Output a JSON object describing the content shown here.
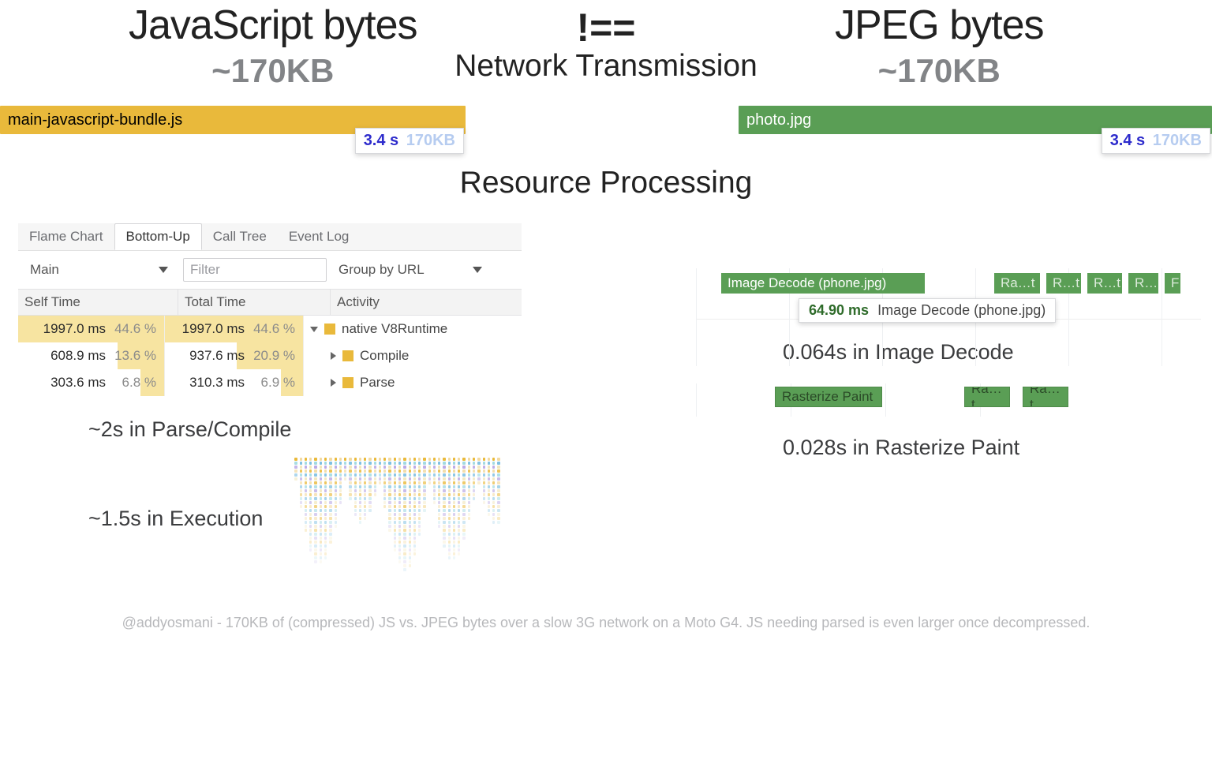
{
  "title_left": "JavaScript bytes",
  "title_neq": "!==",
  "title_right": "JPEG bytes",
  "size_left": "~170KB",
  "size_right": "~170KB",
  "heading_network": "Network Transmission",
  "heading_resource": "Resource Processing",
  "bars": {
    "js": {
      "label": "main-javascript-bundle.js",
      "time": "3.4 s",
      "size": "170KB"
    },
    "jpeg": {
      "label": "photo.jpg",
      "time": "3.4 s",
      "size": "170KB"
    }
  },
  "devtools": {
    "tabs": [
      "Flame Chart",
      "Bottom-Up",
      "Call Tree",
      "Event Log"
    ],
    "active_tab_index": 1,
    "main_select": "Main",
    "filter_placeholder": "Filter",
    "group_label": "Group by URL",
    "cols": [
      "Self Time",
      "Total Time",
      "Activity"
    ],
    "rows": [
      {
        "self_ms": "1997.0 ms",
        "self_pct": "44.6 %",
        "self_fill": 100,
        "total_ms": "1997.0 ms",
        "total_pct": "44.6 %",
        "total_fill": 100,
        "activity": "native V8Runtime",
        "indent": 0,
        "tri": "down"
      },
      {
        "self_ms": "608.9 ms",
        "self_pct": "13.6 %",
        "self_fill": 32,
        "total_ms": "937.6 ms",
        "total_pct": "20.9 %",
        "total_fill": 48,
        "activity": "Compile",
        "indent": 1,
        "tri": "right"
      },
      {
        "self_ms": "303.6 ms",
        "self_pct": "6.8 %",
        "self_fill": 16,
        "total_ms": "310.3 ms",
        "total_pct": "6.9 %",
        "total_fill": 16,
        "activity": "Parse",
        "indent": 1,
        "tri": "right"
      }
    ]
  },
  "decode": {
    "main_label": "Image Decode (phone.jpg)",
    "tip_ms": "64.90 ms",
    "tip_label": "Image Decode (phone.jpg)",
    "small": [
      "Ra…t",
      "R…t",
      "R…t",
      "R…",
      "F"
    ]
  },
  "captions": {
    "parse": "~2s in Parse/Compile",
    "exec": "~1.5s in Execution",
    "decode": "0.064s in Image Decode",
    "raster": "0.028s in Rasterize Paint"
  },
  "raster": {
    "blocks": [
      "Rasterize Paint",
      "Ra…t",
      "Ra…t"
    ]
  },
  "footer": "@addyosmani - 170KB of (compressed) JS vs. JPEG bytes over a slow 3G network on a Moto G4. JS needing parsed is even larger once decompressed."
}
